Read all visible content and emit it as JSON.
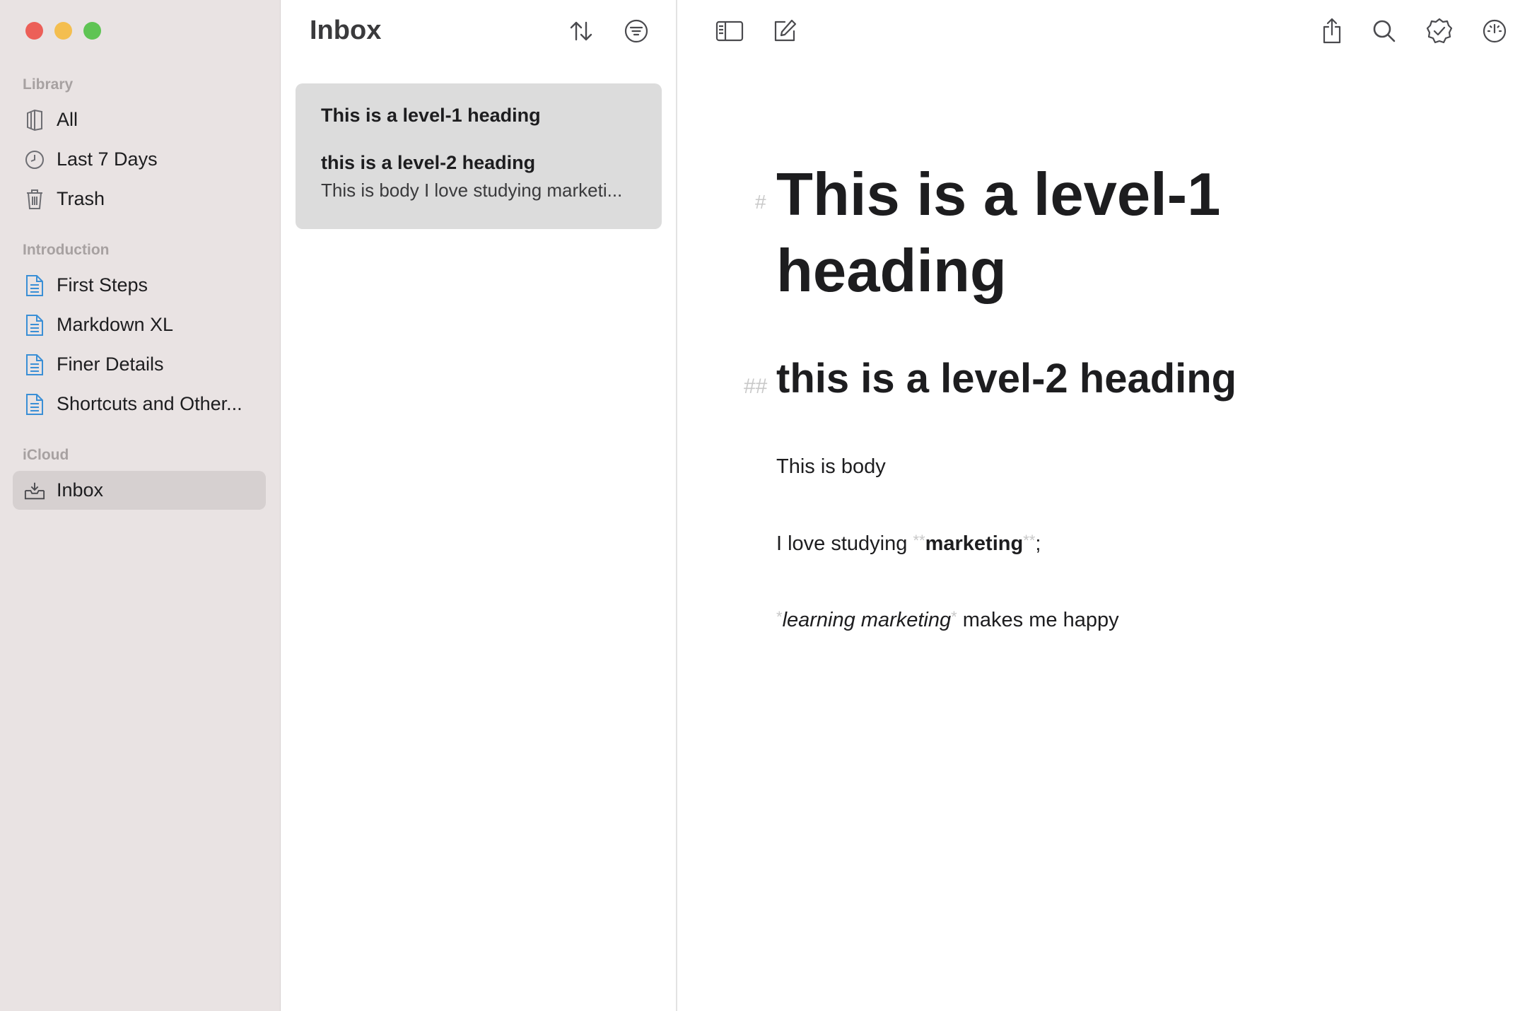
{
  "sidebar": {
    "sections": [
      {
        "header": "Library",
        "items": [
          {
            "label": "All",
            "icon": "book-icon"
          },
          {
            "label": "Last 7 Days",
            "icon": "clock-icon"
          },
          {
            "label": "Trash",
            "icon": "trash-icon"
          }
        ]
      },
      {
        "header": "Introduction",
        "items": [
          {
            "label": "First Steps",
            "icon": "document-icon"
          },
          {
            "label": "Markdown XL",
            "icon": "document-icon"
          },
          {
            "label": "Finer Details",
            "icon": "document-icon"
          },
          {
            "label": "Shortcuts and Other...",
            "icon": "document-icon"
          }
        ]
      },
      {
        "header": "iCloud",
        "items": [
          {
            "label": "Inbox",
            "icon": "inbox-tray-icon",
            "selected": true
          }
        ]
      }
    ]
  },
  "notelist": {
    "title": "Inbox",
    "notes": [
      {
        "title": "This is a level-1 heading",
        "subtitle": "this is a level-2 heading",
        "preview": "This is body I love studying marketi..."
      }
    ]
  },
  "editor": {
    "h1_mark": "#",
    "h1": "This is a level-1 heading",
    "h2_mark": "##",
    "h2": "this is a level-2 heading",
    "body": "This is body",
    "line2_prefix": "I love studying ",
    "bold_mark": "**",
    "bold_word": "marketing",
    "line2_suffix": ";",
    "italic_mark": "*",
    "italic_text": "learning marketing",
    "line3_suffix": " makes me happy"
  },
  "colors": {
    "sidebar_bg": "#e9e3e3",
    "selected_bg": "#d6d0d0",
    "accent_doc": "#3a8fd6",
    "close": "#ec5f58",
    "minimize": "#f4be4f",
    "maximize": "#5fc454"
  }
}
